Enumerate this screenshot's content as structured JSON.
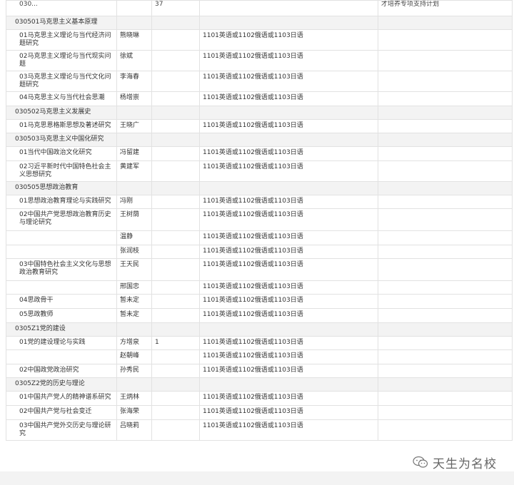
{
  "top_row": {
    "code": "030...",
    "col3": "37",
    "note": "人才培养专项支持计划",
    "note_full": "才培养专项支持计划"
  },
  "rows": [
    {
      "type": "section",
      "c1": "030501马克思主义基本原理"
    },
    {
      "type": "item",
      "c1": "01马克思主义理论与当代经济问题研究",
      "c2": "熊晓琳",
      "c3": "",
      "c4": "1101英语或1102俄语或1103日语",
      "c5": ""
    },
    {
      "type": "item",
      "c1": "02马克思主义理论与当代现实问题",
      "c2": "徐斌",
      "c3": "",
      "c4": "1101英语或1102俄语或1103日语",
      "c5": ""
    },
    {
      "type": "item",
      "c1": "03马克思主义理论与当代文化问题研究",
      "c2": "李海春",
      "c3": "",
      "c4": "1101英语或1102俄语或1103日语",
      "c5": ""
    },
    {
      "type": "item",
      "c1": "04马克思主义与当代社会思潮",
      "c2": "杨增崇",
      "c3": "",
      "c4": "1101英语或1102俄语或1103日语",
      "c5": ""
    },
    {
      "type": "section",
      "c1": "030502马克思主义发展史"
    },
    {
      "type": "item",
      "c1": "01马克思恩格斯思想及著述研究",
      "c2": "王晓广",
      "c3": "",
      "c4": "1101英语或1102俄语或1103日语",
      "c5": ""
    },
    {
      "type": "section",
      "c1": "030503马克思主义中国化研究"
    },
    {
      "type": "item",
      "c1": "01当代中国政治文化研究",
      "c2": "冯留建",
      "c3": "",
      "c4": "1101英语或1102俄语或1103日语",
      "c5": ""
    },
    {
      "type": "item",
      "c1": "02习近平新时代中国特色社会主义思想研究",
      "c2": "黄建军",
      "c3": "",
      "c4": "1101英语或1102俄语或1103日语",
      "c5": ""
    },
    {
      "type": "section",
      "c1": "030505思想政治教育"
    },
    {
      "type": "item",
      "c1": "01思想政治教育理论与实践研究",
      "c2": "冯刚",
      "c3": "",
      "c4": "1101英语或1102俄语或1103日语",
      "c5": ""
    },
    {
      "type": "item",
      "tall": true,
      "c1": "02中国共产党思想政治教育历史与理论研究",
      "c2": "王树荫",
      "c3": "",
      "c4": "1101英语或1102俄语或1103日语",
      "c5": ""
    },
    {
      "type": "item",
      "c1": "",
      "c2": "温静",
      "c3": "",
      "c4": "1101英语或1102俄语或1103日语",
      "c5": ""
    },
    {
      "type": "item",
      "c1": "",
      "c2": "张润枝",
      "c3": "",
      "c4": "1101英语或1102俄语或1103日语",
      "c5": ""
    },
    {
      "type": "item",
      "tall": true,
      "c1": "03中国特色社会主义文化与思想政治教育研究",
      "c2": "王天民",
      "c3": "",
      "c4": "1101英语或1102俄语或1103日语",
      "c5": ""
    },
    {
      "type": "item",
      "c1": "",
      "c2": "邢国忠",
      "c3": "",
      "c4": "1101英语或1102俄语或1103日语",
      "c5": ""
    },
    {
      "type": "item",
      "c1": "04思政骨干",
      "c2": "暂未定",
      "c3": "",
      "c4": "1101英语或1102俄语或1103日语",
      "c5": ""
    },
    {
      "type": "item",
      "c1": "05思政教师",
      "c2": "暂未定",
      "c3": "",
      "c4": "1101英语或1102俄语或1103日语",
      "c5": ""
    },
    {
      "type": "section",
      "c1": "0305Z1党的建设"
    },
    {
      "type": "item",
      "c1": "01党的建设理论与实践",
      "c2": "方增泉",
      "c3": "1",
      "c4": "1101英语或1102俄语或1103日语",
      "c5": ""
    },
    {
      "type": "item",
      "c1": "",
      "c2": "赵朝峰",
      "c3": "",
      "c4": "1101英语或1102俄语或1103日语",
      "c5": ""
    },
    {
      "type": "item",
      "c1": "02中国政党政治研究",
      "c2": "孙秀民",
      "c3": "",
      "c4": "1101英语或1102俄语或1103日语",
      "c5": ""
    },
    {
      "type": "section",
      "c1": "0305Z2党的历史与理论"
    },
    {
      "type": "item",
      "c1": "01中国共产党人的精神谱系研究",
      "c2": "王炳林",
      "c3": "",
      "c4": "1101英语或1102俄语或1103日语",
      "c5": ""
    },
    {
      "type": "item",
      "c1": "02中国共产党与社会变迁",
      "c2": "张海荣",
      "c3": "",
      "c4": "1101英语或1102俄语或1103日语",
      "c5": ""
    },
    {
      "type": "item",
      "c1": "03中国共产党外交历史与理论研究",
      "c2": "吕晓莉",
      "c3": "",
      "c4": "1101英语或1102俄语或1103日语",
      "c5": ""
    }
  ],
  "watermark": {
    "text": "天生为名校",
    "icon": "wechat-icon"
  }
}
